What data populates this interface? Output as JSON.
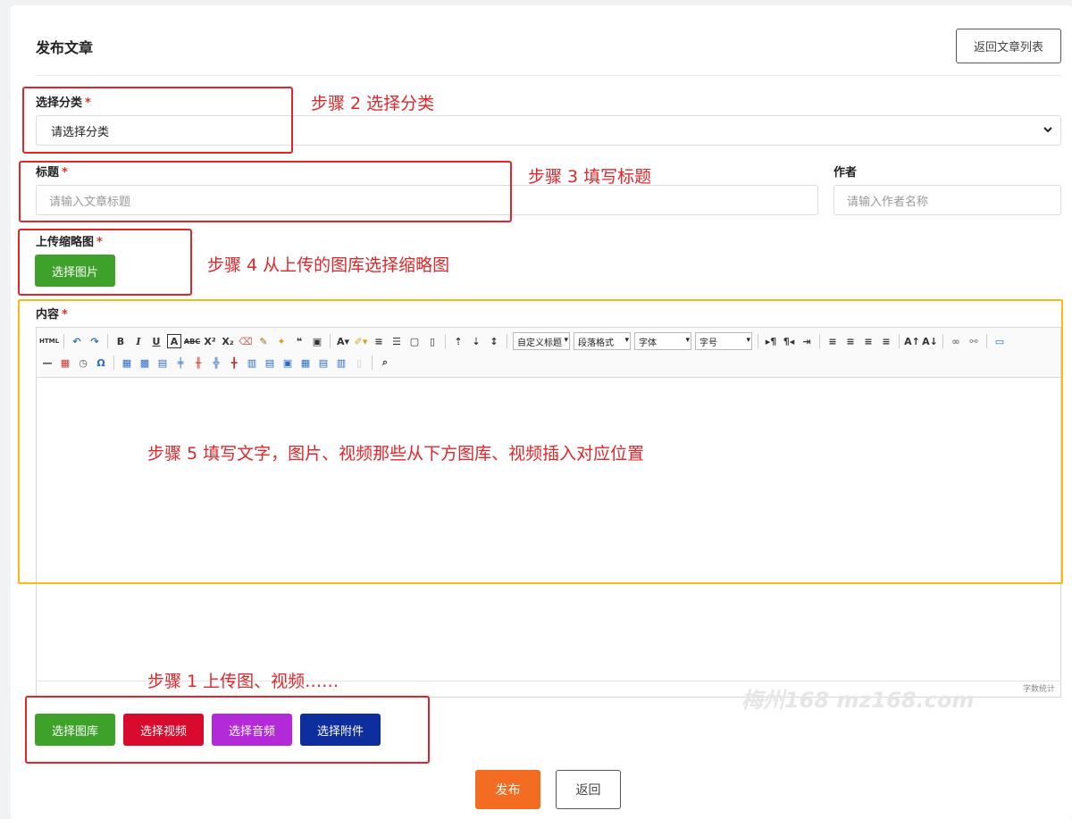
{
  "header": {
    "title": "发布文章",
    "back_list_label": "返回文章列表"
  },
  "form": {
    "category": {
      "label": "选择分类",
      "required_mark": "*",
      "value": "请选择分类"
    },
    "title": {
      "label": "标题",
      "required_mark": "*",
      "placeholder": "请输入文章标题"
    },
    "author": {
      "label": "作者",
      "placeholder": "请输入作者名称"
    },
    "thumbnail": {
      "label": "上传缩略图",
      "required_mark": "*",
      "button_label": "选择图片"
    },
    "content": {
      "label": "内容",
      "required_mark": "*"
    }
  },
  "editor": {
    "toolbar_combos": [
      "自定义标题",
      "段落格式",
      "字体",
      "字号"
    ],
    "html_icon_label": "HTML",
    "word_count_label": "字数统计"
  },
  "media_buttons": [
    {
      "label": "选择图库",
      "color": "#3ea22a"
    },
    {
      "label": "选择视频",
      "color": "#d80a2e"
    },
    {
      "label": "选择音频",
      "color": "#b32ad9"
    },
    {
      "label": "选择附件",
      "color": "#0d2e9c"
    }
  ],
  "actions": {
    "publish_label": "发布",
    "back_label": "返回",
    "publish_color": "#f26c21"
  },
  "annotations": {
    "step1": "步骤 1 上传图、视频……",
    "step2": "步骤 2 选择分类",
    "step3": "步骤 3 填写标题",
    "step4": "步骤 4 从上传的图库选择缩略图",
    "step5": "步骤 5 填写文字，图片、视频那些从下方图库、视频插入对应位置"
  },
  "watermark": "梅州168 mz168.com"
}
